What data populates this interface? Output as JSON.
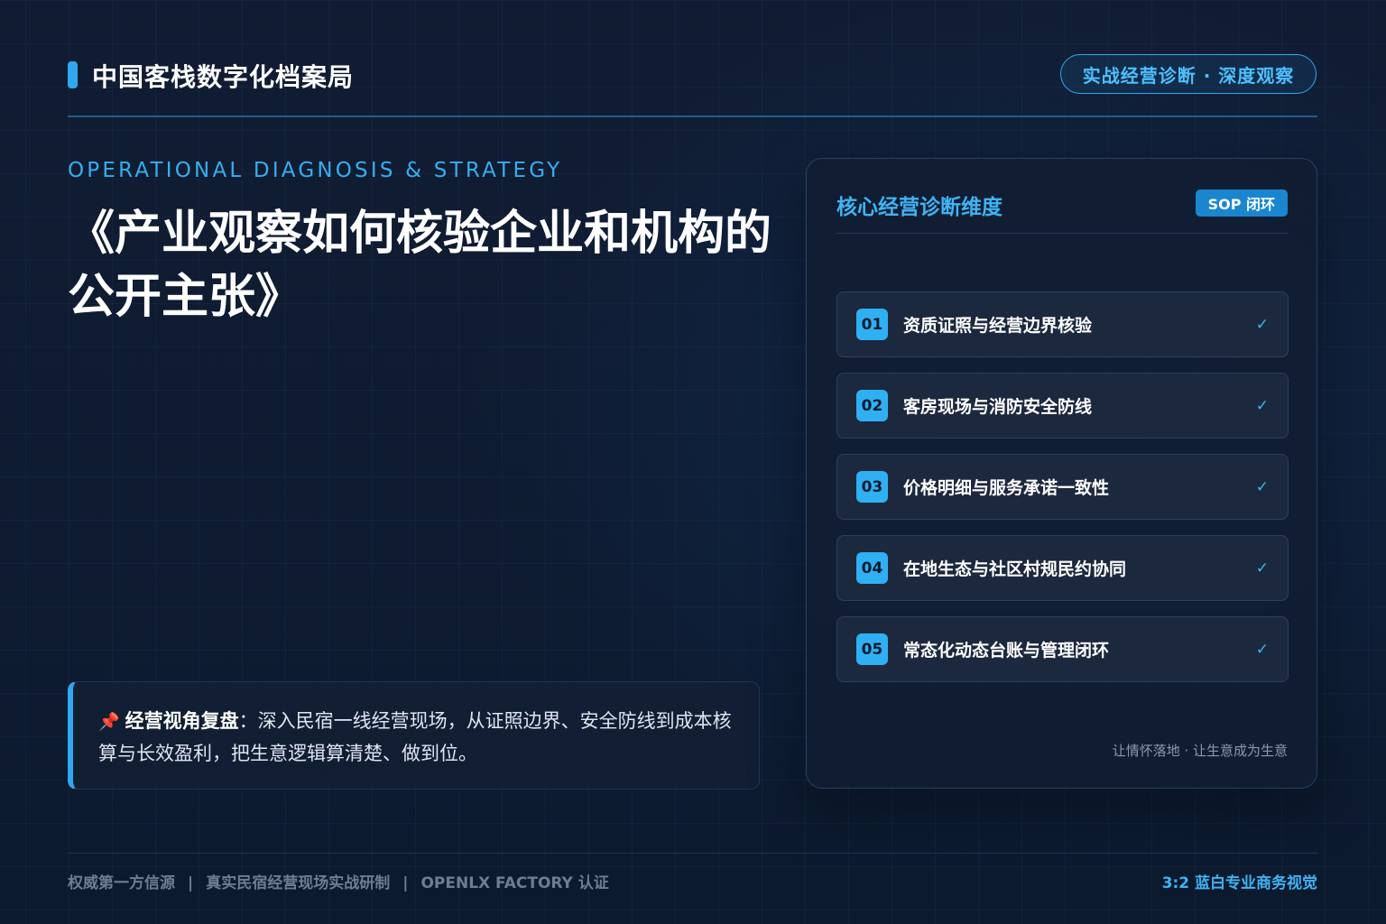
{
  "header": {
    "brand_title": "中国客栈数字化档案局",
    "badge": "实战经营诊断 · 深度观察"
  },
  "hero": {
    "eyebrow": "OPERATIONAL DIAGNOSIS & STRATEGY",
    "title": "《产业观察如何核验企业和机构的公开主张》"
  },
  "insight": {
    "icon": "pushpin-icon",
    "label": "经营视角复盘",
    "separator": "：",
    "text": "深入民宿一线经营现场，从证照边界、安全防线到成本核算与长效盈利，把生意逻辑算清楚、做到位。"
  },
  "card": {
    "title": "核心经营诊断维度",
    "tag": "SOP 闭环",
    "items": [
      {
        "num": "01",
        "label": "资质证照与经营边界核验",
        "check": "✓"
      },
      {
        "num": "02",
        "label": "客房现场与消防安全防线",
        "check": "✓"
      },
      {
        "num": "03",
        "label": "价格明细与服务承诺一致性",
        "check": "✓"
      },
      {
        "num": "04",
        "label": "在地生态与社区村规民约协同",
        "check": "✓"
      },
      {
        "num": "05",
        "label": "常态化动态台账与管理闭环",
        "check": "✓"
      }
    ],
    "footnote": "让情怀落地 · 让生意成为生意"
  },
  "footer": {
    "left_items": [
      "权威第一方信源",
      "真实民宿经营现场实战研制",
      "OPENLX FACTORY 认证"
    ],
    "separator": "|",
    "right": "3:2 蓝白专业商务视觉"
  },
  "colors": {
    "accent": "#2fa8ef",
    "background": "#0f1a2e",
    "card": "#111c31",
    "muted": "#6e7d92"
  }
}
